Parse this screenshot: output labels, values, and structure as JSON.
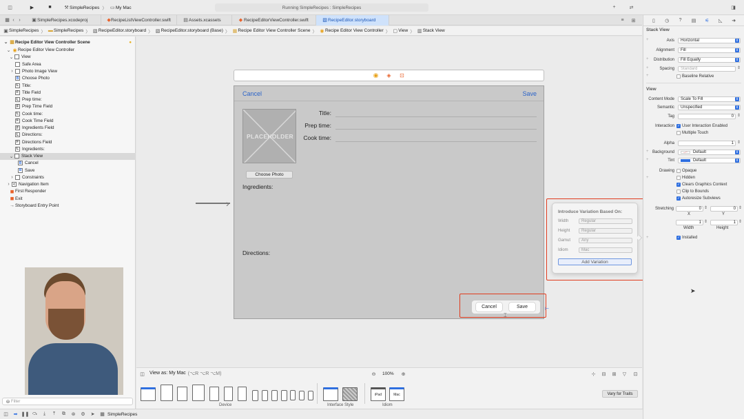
{
  "toolbar": {
    "scheme": "SimpleRecipes",
    "destination": "My Mac",
    "status": "Running SimpleRecipes : SimpleRecipes"
  },
  "tabs": [
    {
      "label": "SimpleRecipes.xcodeproj"
    },
    {
      "label": "RecipeListViewController.swift"
    },
    {
      "label": "Assets.xcassets"
    },
    {
      "label": "RecipeEditorViewController.swift"
    },
    {
      "label": "RecipeEditor.storyboard"
    }
  ],
  "jumpbar": [
    {
      "label": "SimpleRecipes"
    },
    {
      "label": "SimpleRecipes"
    },
    {
      "label": "RecipeEditor.storyboard"
    },
    {
      "label": "RecipeEditor.storyboard (Base)"
    },
    {
      "label": "Recipe Editor View Controller Scene"
    },
    {
      "label": "Recipe Editor View Controller"
    },
    {
      "label": "View"
    },
    {
      "label": "Stack View"
    }
  ],
  "outline": [
    {
      "label": "Recipe Editor View Controller Scene",
      "badge": "",
      "bold": true
    },
    {
      "label": "Recipe Editor View Controller",
      "badge": "●"
    },
    {
      "label": "View",
      "badge": ""
    },
    {
      "label": "Safe Area",
      "badge": ""
    },
    {
      "label": "Photo Image View",
      "badge": ""
    },
    {
      "label": "Choose Photo",
      "badge": "B"
    },
    {
      "label": "Title:",
      "badge": "L"
    },
    {
      "label": "Title Field",
      "badge": "F"
    },
    {
      "label": "Prep time:",
      "badge": "L"
    },
    {
      "label": "Prep Time Field",
      "badge": "F"
    },
    {
      "label": "Cook time:",
      "badge": "L"
    },
    {
      "label": "Cook Time Field",
      "badge": "F"
    },
    {
      "label": "Ingredients Field",
      "badge": "F"
    },
    {
      "label": "Directions:",
      "badge": "L"
    },
    {
      "label": "Directions Field",
      "badge": "F"
    },
    {
      "label": "Ingredients:",
      "badge": "L"
    },
    {
      "label": "Stack View",
      "badge": "",
      "selected": true
    },
    {
      "label": "Cancel",
      "badge": "B"
    },
    {
      "label": "Save",
      "badge": "B"
    },
    {
      "label": "Constraints",
      "badge": ""
    },
    {
      "label": "Navigation Item",
      "badge": "<"
    },
    {
      "label": "First Responder",
      "badge": ""
    },
    {
      "label": "Exit",
      "badge": ""
    },
    {
      "label": "Storyboard Entry Point",
      "badge": ""
    }
  ],
  "filter_placeholder": "Filter",
  "scene": {
    "cancel": "Cancel",
    "save": "Save",
    "placeholder": "PLACEHOLDER",
    "title_label": "Title:",
    "prep_label": "Prep time:",
    "cook_label": "Cook time:",
    "choose_photo": "Choose Photo",
    "ingredients": "Ingredients:",
    "directions": "Directions:",
    "stack_cancel": "Cancel",
    "stack_save": "Save"
  },
  "bottom": {
    "view_as": "View as: My Mac",
    "view_as_keys": "(⌥R ⌥R ⌥M)",
    "zoom": "100%",
    "device": "Device",
    "interface_style": "Interface Style",
    "idiom": "Idiom",
    "ipad": "iPad",
    "mac": "Mac",
    "vary": "Vary for Traits"
  },
  "variation": {
    "title": "Introduce Variation Based On:",
    "rows": [
      {
        "label": "Width",
        "value": "Regular"
      },
      {
        "label": "Height",
        "value": "Regular"
      },
      {
        "label": "Gamut",
        "value": "Any"
      },
      {
        "label": "Idiom",
        "value": "Mac"
      }
    ],
    "add": "Add Variation"
  },
  "inspector": {
    "stack_title": "Stack View",
    "axis_label": "Axis",
    "axis": "Horizontal",
    "alignment_label": "Alignment",
    "alignment": "Fill",
    "distribution_label": "Distribution",
    "distribution": "Fill Equally",
    "spacing_label": "Spacing",
    "spacing": "Standard",
    "baseline": "Baseline Relative",
    "view_title": "View",
    "content_mode_label": "Content Mode",
    "content_mode": "Scale To Fill",
    "semantic_label": "Semantic",
    "semantic": "Unspecified",
    "tag_label": "Tag",
    "tag": "0",
    "interaction_label": "Interaction",
    "user_interaction": "User Interaction Enabled",
    "multiple_touch": "Multiple Touch",
    "alpha_label": "Alpha",
    "alpha": "1",
    "background_label": "Background",
    "background": "Default",
    "tint_label": "Tint",
    "tint": "Default",
    "drawing_label": "Drawing",
    "opaque": "Opaque",
    "hidden": "Hidden",
    "clears": "Clears Graphics Context",
    "clip": "Clip to Bounds",
    "autoresize": "Autoresize Subviews",
    "stretching_label": "Stretching",
    "stretch_x": "0",
    "stretch_y": "0",
    "stretch_w": "1",
    "stretch_h": "1",
    "x_label": "X",
    "y_label": "Y",
    "width_label": "Width",
    "height_label": "Height",
    "installed": "Installed"
  },
  "statusbar": {
    "target": "SimpleRecipes"
  },
  "colors": {
    "accent": "#2f6fe0",
    "highlight": "#e03a1c",
    "scene_bg": "#c9c9c9"
  }
}
